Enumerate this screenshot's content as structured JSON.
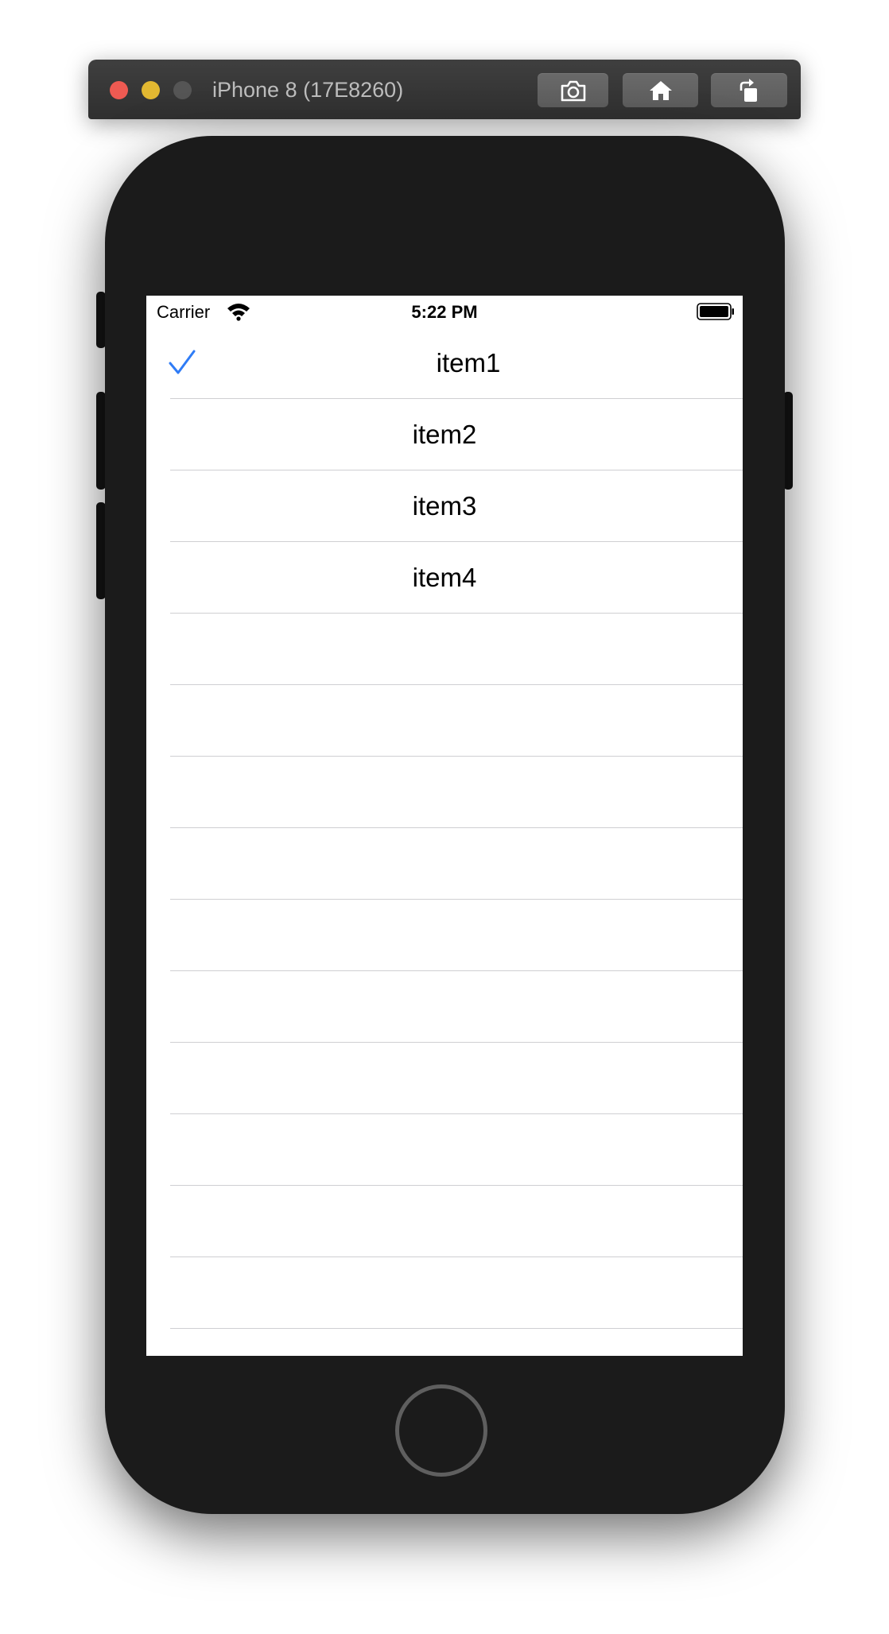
{
  "window": {
    "title": "iPhone 8 (17E8260)",
    "toolbar": {
      "screenshot_icon": "camera-icon",
      "home_icon": "home-icon",
      "rotate_icon": "rotate-icon"
    }
  },
  "status_bar": {
    "carrier": "Carrier",
    "time": "5:22 PM",
    "wifi_icon": "wifi-icon",
    "battery_icon": "battery-icon"
  },
  "table": {
    "accent_color": "#2f7cf6",
    "rows": [
      {
        "label": "item1",
        "checked": true
      },
      {
        "label": "item2",
        "checked": false
      },
      {
        "label": "item3",
        "checked": false
      },
      {
        "label": "item4",
        "checked": false
      },
      {
        "label": "",
        "checked": false
      },
      {
        "label": "",
        "checked": false
      },
      {
        "label": "",
        "checked": false
      },
      {
        "label": "",
        "checked": false
      },
      {
        "label": "",
        "checked": false
      },
      {
        "label": "",
        "checked": false
      },
      {
        "label": "",
        "checked": false
      },
      {
        "label": "",
        "checked": false
      },
      {
        "label": "",
        "checked": false
      },
      {
        "label": "",
        "checked": false
      },
      {
        "label": "",
        "checked": false
      }
    ]
  }
}
